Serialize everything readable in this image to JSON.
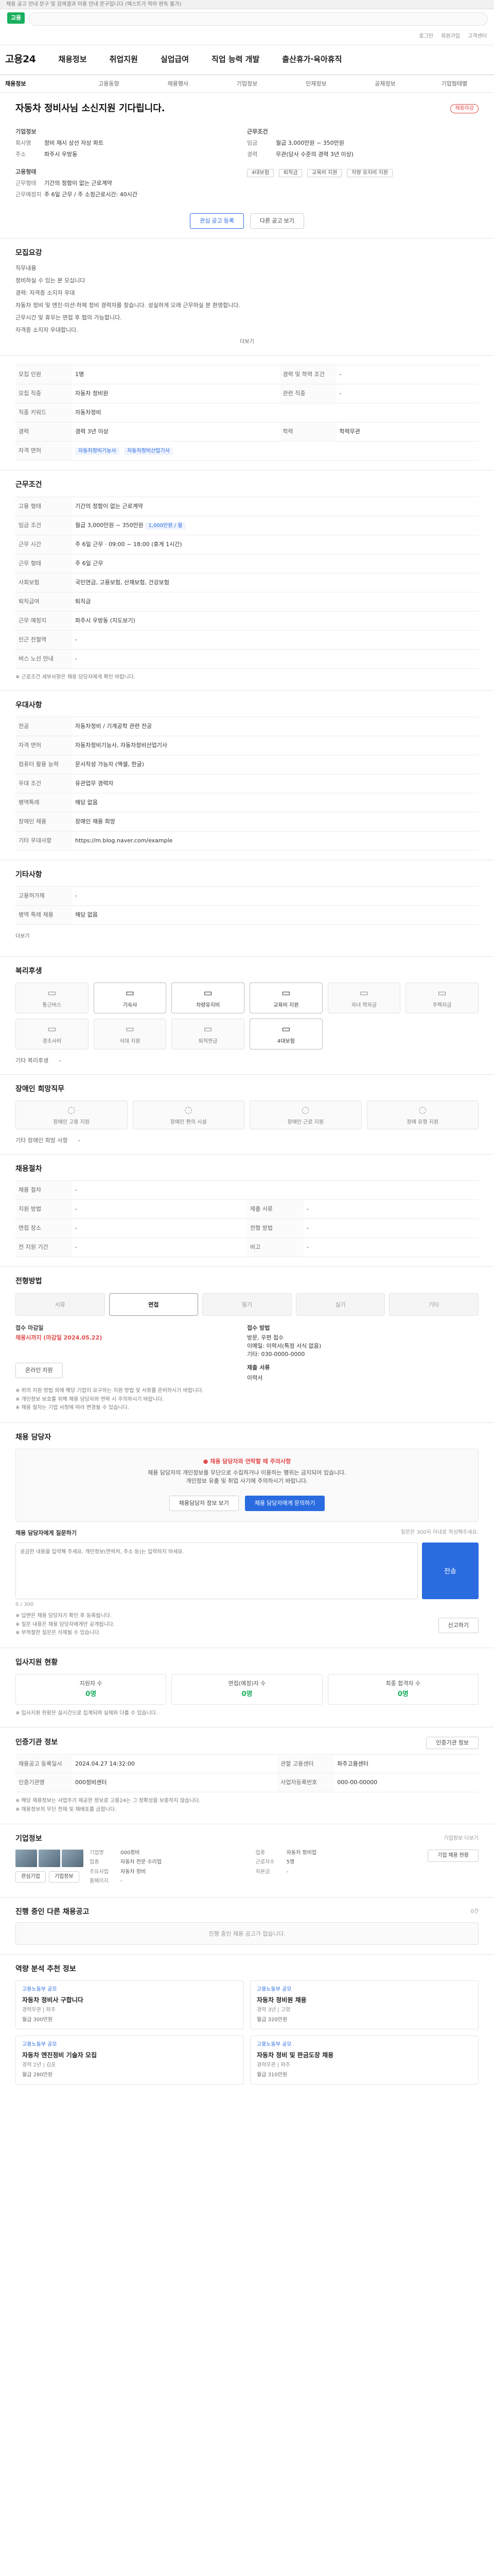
{
  "notice": "채용 공고 안내 문구 및 검색결과 이용 안내 문구입니다 (텍스트가 작아 판독 불가)",
  "header": {
    "logo": "고용",
    "util": [
      "로그인",
      "회원가입",
      "고객센터"
    ]
  },
  "gnb": {
    "brand": "고용24",
    "items": [
      "채용정보",
      "취업지원",
      "실업급여",
      "직업 능력 개발",
      "출산휴가·육아휴직"
    ]
  },
  "lnb": [
    "채용정보",
    "고용동향",
    "채용행사",
    "기업정보",
    "인재정보",
    "공채정보",
    "기업형태별"
  ],
  "job": {
    "title": "자동차 정비사님 소신지원 기다립니다.",
    "badge": "채용마감",
    "employer_label": "기업정보",
    "employer_name_key": "회사명",
    "employer_name": "정비 재시 상선 자상 파트",
    "employer_loc_key": "주소",
    "employer_loc": "파주시 우방동",
    "employment_label": "고용형태",
    "employment": [
      {
        "k": "근무형태",
        "v": "기간의 정함이 없는 근로계약"
      },
      {
        "k": "근무예정지",
        "v": "주 6일 근무 / 주 소정근로시간: 40시간"
      }
    ],
    "conditions_label": "근무조건",
    "conditions": [
      {
        "k": "임금",
        "v": "월급 3,000만원 ~ 350만원"
      },
      {
        "k": "경력",
        "v": "무관(당사 수준의 경력 3년 이상)"
      }
    ],
    "chips": [
      "4대보험",
      "퇴직금",
      "교육비 지원",
      "차량 유지비 지원"
    ],
    "btn_interest": "관심 공고 등록",
    "btn_compare": "다른 공고 보기"
  },
  "desc": {
    "title": "모집요강",
    "lines": [
      "직무내용",
      "정비하실 수 있는 분 모십니다",
      "경력: 자격증 소지자 우대",
      "자동차 정비 및 엔진·미션·하체 정비 경력자를 찾습니다. 성실하게 오래 근무하실 분 환영합니다.",
      "근무시간 및 휴무는 면접 후 협의 가능합니다.",
      "자격증 소지자 우대합니다."
    ],
    "more": "더보기"
  },
  "recruit": {
    "rows": [
      {
        "k": "모집 인원",
        "v": "1명",
        "k2": "경력 및 학력 조건",
        "v2": "-"
      },
      {
        "k": "모집 직종",
        "v": "자동차 정비원",
        "k2": "관련 직종",
        "v2": "-"
      },
      {
        "k": "직종 키워드",
        "v": "자동차정비",
        "k2": "",
        "v2": ""
      },
      {
        "k": "경력",
        "v": "경력 3년 이상",
        "k2": "학력",
        "v2": "학력무관"
      }
    ],
    "lic_key": "자격 면허",
    "lic": [
      "자동차정비기능사",
      "자동차정비산업기사"
    ]
  },
  "work": {
    "title": "근무조건",
    "rows": [
      {
        "k": "고용 형태",
        "v": "기간의 정함이 없는 근로계약"
      },
      {
        "k": "임금 조건",
        "v": "월급 3,000만원 ~ 350만원"
      },
      {
        "k": "근무 시간",
        "v": "주 6일 근무 · 09:00 ~ 18:00 (휴게 1시간)"
      },
      {
        "k": "근무 형태",
        "v": "주 6일 근무"
      },
      {
        "k": "사회보험",
        "v": "국민연금, 고용보험, 산재보험, 건강보험"
      },
      {
        "k": "퇴직급여",
        "v": "퇴직금"
      },
      {
        "k": "근무 예정지",
        "v": "파주시 우방동 (지도보기)"
      },
      {
        "k": "인근 전철역",
        "v": "-"
      },
      {
        "k": "버스 노선 안내",
        "v": "-"
      }
    ],
    "badge_wage": "1,000만원 / 월",
    "note": "※ 근로조건 세부사항은 채용 담당자에게 확인 바랍니다."
  },
  "extra": {
    "title": "우대사항",
    "rows": [
      {
        "k": "전공",
        "v": "자동차정비 / 기계공학 관련 전공"
      },
      {
        "k": "자격 면허",
        "v": "자동차정비기능사, 자동차정비산업기사"
      },
      {
        "k": "컴퓨터 활용 능력",
        "v": "문서작성 가능자 (엑셀, 한글)"
      },
      {
        "k": "우대 조건",
        "v": "유관업무 경력자"
      },
      {
        "k": "병역특례",
        "v": "해당 없음"
      },
      {
        "k": "장애인 채용",
        "v": "장애인 채용 희망"
      },
      {
        "k": "기타 우대사항",
        "v": "https://m.blog.naver.com/example"
      }
    ]
  },
  "etc": {
    "title": "기타사항",
    "rows": [
      {
        "k": "고용허가제",
        "v": "-"
      },
      {
        "k": "병역 특례 채용",
        "v": "해당 없음"
      }
    ],
    "more": "더보기"
  },
  "welfare": {
    "title": "복리후생",
    "items": [
      {
        "label": "통근버스",
        "icon": "bus-icon",
        "glyph": "▭",
        "on": false
      },
      {
        "label": "기숙사",
        "icon": "bed-icon",
        "glyph": "▭",
        "on": true
      },
      {
        "label": "차량유지비",
        "icon": "car-icon",
        "glyph": "▭",
        "on": true
      },
      {
        "label": "교육비 지원",
        "icon": "book-icon",
        "glyph": "▭",
        "on": true
      },
      {
        "label": "자녀 학자금",
        "icon": "child-icon",
        "glyph": "▭",
        "on": false
      },
      {
        "label": "주택자금",
        "icon": "home-icon",
        "glyph": "▭",
        "on": false
      },
      {
        "label": "경조사비",
        "icon": "gift-icon",
        "glyph": "▭",
        "on": false
      },
      {
        "label": "식대 지원",
        "icon": "meal-icon",
        "glyph": "▭",
        "on": false
      },
      {
        "label": "퇴직연금",
        "icon": "pension-icon",
        "glyph": "▭",
        "on": false
      },
      {
        "label": "4대보험",
        "icon": "shield-icon",
        "glyph": "▭",
        "on": true
      }
    ],
    "extra_key": "기타 복리후생",
    "extra": "-"
  },
  "disability": {
    "title": "장애인 희망직무",
    "items": [
      "장애인 고용 지원",
      "장애인 편의 시설",
      "장애인 근로 지원",
      "장애 유형 지원"
    ],
    "extra_key": "기타 장애인 희망 사항",
    "extra": "-"
  },
  "process": {
    "title": "채용절차",
    "rows": [
      {
        "k": "채용 절차",
        "v": "-",
        "k2": "",
        "v2": ""
      },
      {
        "k": "지원 방법",
        "v": "-",
        "k2": "제출 서류",
        "v2": "-"
      },
      {
        "k": "면접 장소",
        "v": "-",
        "k2": "전형 방법",
        "v2": "-"
      },
      {
        "k": "전 지원 기간",
        "v": "-",
        "k2": "비고",
        "v2": "-"
      }
    ]
  },
  "apply": {
    "title": "전형방법",
    "tabs": [
      "서류",
      "면접",
      "필기",
      "실기",
      "기타"
    ],
    "active": 1,
    "period_label": "접수 마감일",
    "period": "채용시까지 (마감일 2024.05.22)",
    "method_label": "접수 방법",
    "method": [
      "방문, 우편 접수",
      "이메일: 이력서(특정 서식 없음)",
      "기타: 030-0000-0000"
    ],
    "docs_label": "제출 서류",
    "docs": "이력서",
    "btn": "온라인 지원",
    "notes": [
      "※ 위의 지원 방법 외에 해당 기업이 요구하는 지원 방법 및 서류를 준비하시기 바랍니다.",
      "※ 개인정보 보호를 위해 채용 담당자와 연락 시 주의하시기 바랍니다.",
      "※ 채용 절차는 기업 사정에 따라 변경될 수 있습니다."
    ]
  },
  "contact": {
    "title": "채용 담당자",
    "warn_title": "● 채용 담당자와 연락할 때 주의사항",
    "warn_lines": [
      "채용 담당자의 개인정보를 무단으로 수집하거나 이용하는 행위는 금지되어 있습니다.",
      "개인정보 유출 및 취업 사기에 주의하시기 바랍니다."
    ],
    "btn_a": "채용담당자 정보 보기",
    "btn_b": "채용 담당자에게 문의하기",
    "form_title": "채용 담당자에게 질문하기",
    "form_hint": "질문은 300자 이내로 작성해주세요.",
    "placeholder": "궁금한 내용을 입력해 주세요. 개인정보(연락처, 주소 등)는 입력하지 마세요.",
    "count": "0 / 300",
    "send": "전송",
    "notes": [
      "※ 답변은 채용 담당자가 확인 후 등록됩니다.",
      "※ 질문 내용은 채용 담당자에게만 공개됩니다.",
      "※ 부적절한 질문은 삭제될 수 있습니다."
    ],
    "report": "신고하기"
  },
  "stats": {
    "title": "입사지원 현황",
    "items": [
      {
        "label": "지원자 수",
        "n": "0명"
      },
      {
        "label": "면접(예정)자 수",
        "n": "0명"
      },
      {
        "label": "최종 합격자 수",
        "n": "0명"
      }
    ],
    "note": "※ 입사지원 현황은 실시간으로 집계되며 실제와 다를 수 있습니다."
  },
  "manage": {
    "title": "인증기관 정보",
    "btn": "인증기관 정보",
    "rows": [
      {
        "k": "채용공고 등록일시",
        "v": "2024.04.27 14:32:00",
        "k2": "관할 고용센터",
        "v2": "파주고용센터"
      },
      {
        "k": "인증기관명",
        "v": "000정비센터",
        "k2": "사업자등록번호",
        "v2": "000-00-00000"
      }
    ],
    "notes": [
      "※ 해당 채용정보는 사업주가 제공한 정보로 고용24는 그 정확성을 보증하지 않습니다.",
      "※ 채용정보의 무단 전재 및 재배포를 금합니다."
    ]
  },
  "company": {
    "title": "기업정보",
    "more": "기업정보 더보기",
    "rows": [
      {
        "k": "기업명",
        "v": "000정비",
        "k2": "업종",
        "v2": "자동차 정비업"
      },
      {
        "k": "업종",
        "v": "자동차 전문 수리업",
        "k2": "근로자수",
        "v2": "5명"
      },
      {
        "k": "주요사업",
        "v": "자동차 정비",
        "k2": "자본금",
        "v2": "-"
      },
      {
        "k": "홈페이지",
        "v": "-",
        "k2": "",
        "v2": ""
      }
    ],
    "btn_a": "관심기업",
    "btn_b": "기업정보",
    "side_btn": "기업 채용 현황"
  },
  "ongoing": {
    "title": "진행 중인 다른 채용공고",
    "note": "0건",
    "empty": "진행 중인 채용 공고가 없습니다."
  },
  "recommend": {
    "title": "역량 분석 추천 정보",
    "items": [
      {
        "org": "고용노동부 공모",
        "t": "자동차 정비사 구합니다",
        "m": "경력무관 | 파주",
        "sub": "월급 300만원"
      },
      {
        "org": "고용노동부 공모",
        "t": "자동차 정비원 채용",
        "m": "경력 3년 | 고양",
        "sub": "월급 320만원"
      },
      {
        "org": "고용노동부 공모",
        "t": "자동차 엔진정비 기술자 모집",
        "m": "경력 2년 | 김포",
        "sub": "월급 280만원"
      },
      {
        "org": "고용노동부 공모",
        "t": "자동차 정비 및 판금도장 채용",
        "m": "경력무관 | 파주",
        "sub": "월급 310만원"
      }
    ]
  }
}
